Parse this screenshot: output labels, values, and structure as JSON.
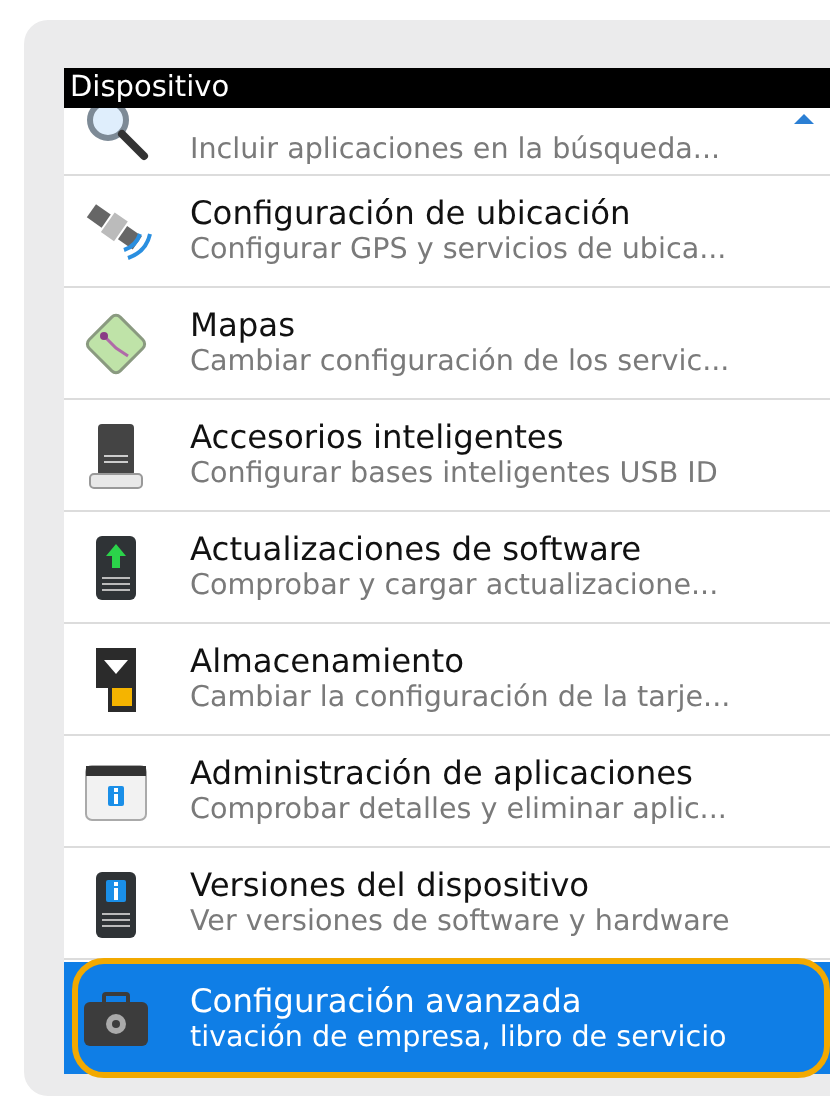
{
  "header": {
    "title": "Dispositivo"
  },
  "items": [
    {
      "subtitle": "Incluir aplicaciones en la búsqueda...",
      "selected": false,
      "highlighted": false
    },
    {
      "title": "Configuración de ubicación",
      "subtitle": "Configurar GPS y servicios de ubica...",
      "selected": false,
      "highlighted": false
    },
    {
      "title": "Mapas",
      "subtitle": "Cambiar configuración de los servic...",
      "selected": false,
      "highlighted": false
    },
    {
      "title": "Accesorios inteligentes",
      "subtitle": "Configurar bases inteligentes USB ID",
      "selected": false,
      "highlighted": false
    },
    {
      "title": "Actualizaciones de software",
      "subtitle": "Comprobar y cargar actualizacione...",
      "selected": false,
      "highlighted": false
    },
    {
      "title": "Almacenamiento",
      "subtitle": "Cambiar la configuración de la tarje...",
      "selected": false,
      "highlighted": false
    },
    {
      "title": "Administración de aplicaciones",
      "subtitle": "Comprobar detalles y eliminar aplic...",
      "selected": false,
      "highlighted": false
    },
    {
      "title": "Versiones del dispositivo",
      "subtitle": "Ver versiones de software y hardware",
      "selected": false,
      "highlighted": false
    },
    {
      "title": "Configuración avanzada",
      "subtitle": "tivación de empresa, libro de servicio",
      "selected": true,
      "highlighted": true
    }
  ]
}
